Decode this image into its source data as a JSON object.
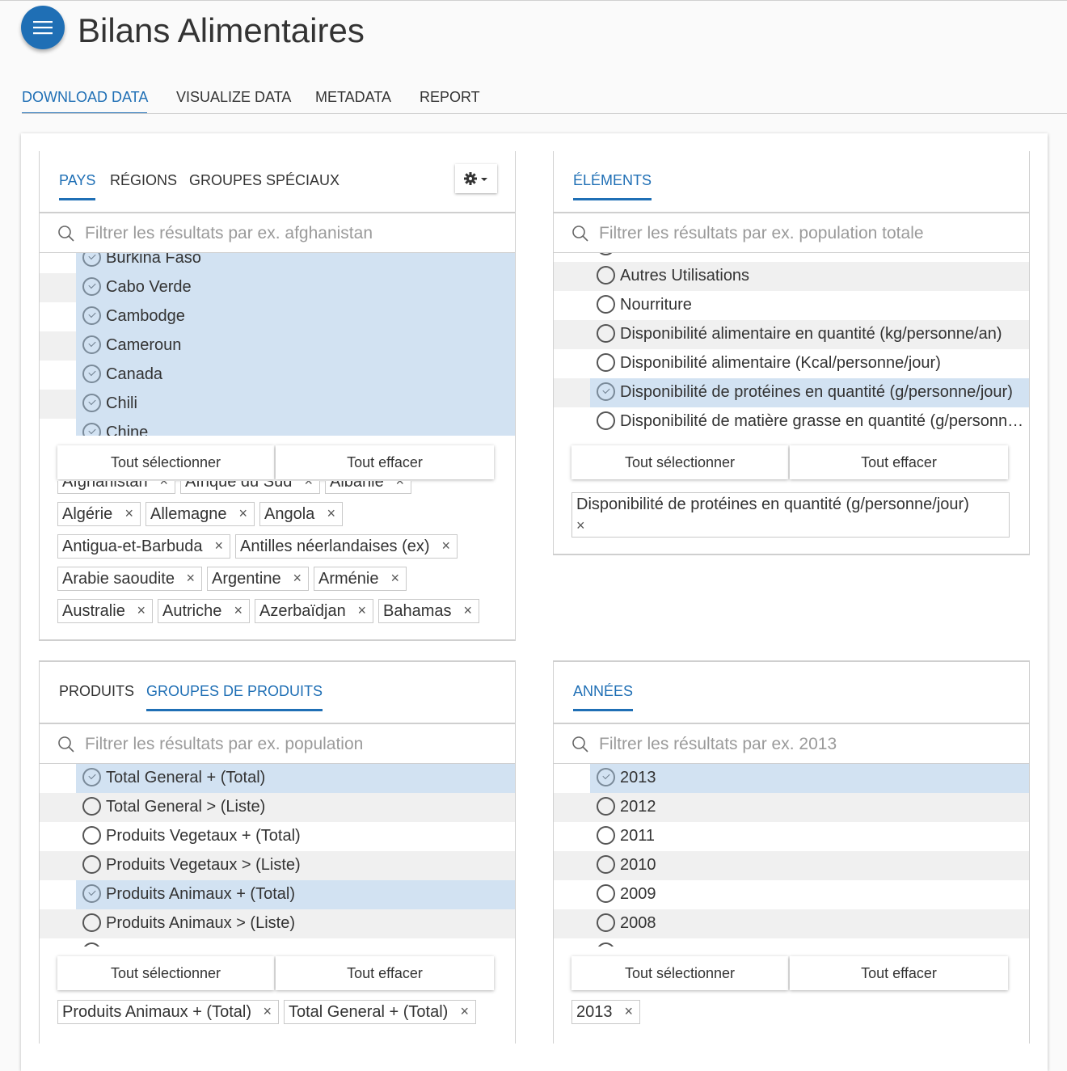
{
  "app": {
    "title": "Bilans Alimentaires"
  },
  "nav_tabs": [
    "DOWNLOAD DATA",
    "VISUALIZE DATA",
    "METADATA",
    "REPORT"
  ],
  "colors": {
    "accent": "#1f6fb5",
    "selected_row": "#d2e2f2",
    "stripe": "#f0f0f0"
  },
  "icons": {
    "menu": "hamburger-menu-icon",
    "settings": "gear-icon",
    "search": "search-icon",
    "remove": "close-icon"
  },
  "common": {
    "select_all": "Tout sélectionner",
    "clear_all": "Tout effacer",
    "remove_glyph": "×"
  },
  "countries": {
    "tabs": [
      "PAYS",
      "RÉGIONS",
      "GROUPES SPÉCIAUX"
    ],
    "search_placeholder": "Filtrer les résultats par ex. afghanistan",
    "items": [
      {
        "label": "Burkina Faso",
        "selected": true
      },
      {
        "label": "Cabo Verde",
        "selected": true
      },
      {
        "label": "Cambodge",
        "selected": true
      },
      {
        "label": "Cameroun",
        "selected": true
      },
      {
        "label": "Canada",
        "selected": true
      },
      {
        "label": "Chili",
        "selected": true
      },
      {
        "label": "Chine",
        "selected": true
      }
    ],
    "chips": [
      "Afghanistan",
      "Afrique du Sud",
      "Albanie",
      "Algérie",
      "Allemagne",
      "Angola",
      "Antigua-et-Barbuda",
      "Antilles néerlandaises (ex)",
      "Arabie saoudite",
      "Argentine",
      "Arménie",
      "Australie",
      "Autriche",
      "Azerbaïdjan",
      "Bahamas"
    ]
  },
  "elements": {
    "tabs": [
      "ÉLÉMENTS"
    ],
    "search_placeholder": "Filtrer les résultats par ex. population totale",
    "items": [
      {
        "label": "Autres Utilisations",
        "selected": false
      },
      {
        "label": "Nourriture",
        "selected": false
      },
      {
        "label": "Disponibilité alimentaire en quantité (kg/personne/an)",
        "selected": false
      },
      {
        "label": "Disponibilité alimentaire (Kcal/personne/jour)",
        "selected": false
      },
      {
        "label": "Disponibilité de protéines en quantité (g/personne/jour)",
        "selected": true
      },
      {
        "label": "Disponibilité de matière grasse en quantité (g/personne/jour)",
        "selected": false
      }
    ],
    "chips": [
      "Disponibilité de protéines en quantité (g/personne/jour)"
    ]
  },
  "products": {
    "tabs": [
      "PRODUITS",
      "GROUPES DE PRODUITS"
    ],
    "search_placeholder": "Filtrer les résultats par ex. population",
    "items": [
      {
        "label": "Total General + (Total)",
        "selected": true
      },
      {
        "label": "Total General > (Liste)",
        "selected": false
      },
      {
        "label": "Produits Vegetaux + (Total)",
        "selected": false
      },
      {
        "label": "Produits Vegetaux > (Liste)",
        "selected": false
      },
      {
        "label": "Produits Animaux + (Total)",
        "selected": true
      },
      {
        "label": "Produits Animaux > (Liste)",
        "selected": false
      }
    ],
    "chips": [
      "Produits Animaux + (Total)",
      "Total General + (Total)"
    ]
  },
  "years": {
    "tabs": [
      "ANNÉES"
    ],
    "search_placeholder": "Filtrer les résultats par ex. 2013",
    "items": [
      {
        "label": "2013",
        "selected": true
      },
      {
        "label": "2012",
        "selected": false
      },
      {
        "label": "2011",
        "selected": false
      },
      {
        "label": "2010",
        "selected": false
      },
      {
        "label": "2009",
        "selected": false
      },
      {
        "label": "2008",
        "selected": false
      }
    ],
    "chips": [
      "2013"
    ]
  }
}
